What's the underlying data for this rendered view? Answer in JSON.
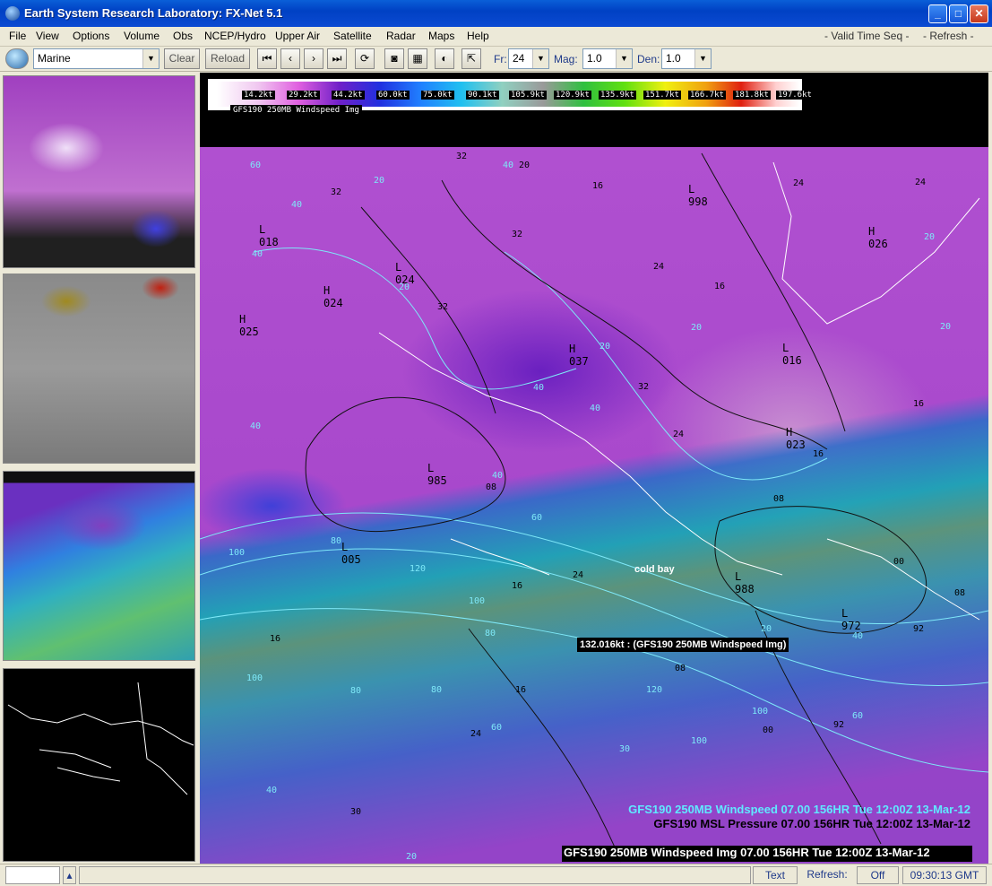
{
  "window": {
    "title": "Earth System Research Laboratory: FX-Net 5.1"
  },
  "menu": {
    "items": [
      "File",
      "View",
      "Options",
      "Volume",
      "Obs",
      "NCEP/Hydro",
      "Upper Air",
      "Satellite",
      "Radar",
      "Maps",
      "Help"
    ],
    "valid_time": "- Valid Time Seq -",
    "refresh": "- Refresh -"
  },
  "toolbar": {
    "region": "Marine",
    "clear": "Clear",
    "reload": "Reload",
    "fr_label": "Fr:",
    "fr_value": "24",
    "mag_label": "Mag:",
    "mag_value": "1.0",
    "den_label": "Den:",
    "den_value": "1.0"
  },
  "colorbar": {
    "labels": [
      "14.2kt",
      "29.2kt",
      "44.2kt",
      "60.0kt",
      "75.0kt",
      "90.1kt",
      "105.9kt",
      "120.9kt",
      "135.9kt",
      "151.7kt",
      "166.7kt",
      "181.8kt",
      "197.6kt"
    ],
    "title": "GFS190 250MB Windspeed Img"
  },
  "map": {
    "pressure_labels": [
      {
        "t": "L",
        "v": "018"
      },
      {
        "t": "L",
        "v": "024"
      },
      {
        "t": "H",
        "v": "024"
      },
      {
        "t": "H",
        "v": "025"
      },
      {
        "t": "H",
        "v": "037"
      },
      {
        "t": "L",
        "v": "016"
      },
      {
        "t": "H",
        "v": "023"
      },
      {
        "t": "H",
        "v": "026"
      },
      {
        "t": "L",
        "v": "005"
      },
      {
        "t": "L",
        "v": "988"
      },
      {
        "t": "L",
        "v": "998"
      },
      {
        "t": "L",
        "v": "985"
      },
      {
        "t": "L",
        "v": "972"
      }
    ],
    "city": "cold bay",
    "tooltip": "132.016kt : (GFS190 250MB Windspeed Img)",
    "legend_1": "GFS190 250MB Windspeed  07.00 156HR Tue 12:00Z 13-Mar-12",
    "legend_2": "GFS190 MSL Pressure  07.00 156HR Tue 12:00Z 13-Mar-12",
    "legend_3": "GFS190 250MB Windspeed Img 07.00 156HR Tue 12:00Z 13-Mar-12"
  },
  "status": {
    "text": "Text",
    "refresh_label": "Refresh:",
    "refresh_value": "Off",
    "time": "09:30:13 GMT"
  }
}
